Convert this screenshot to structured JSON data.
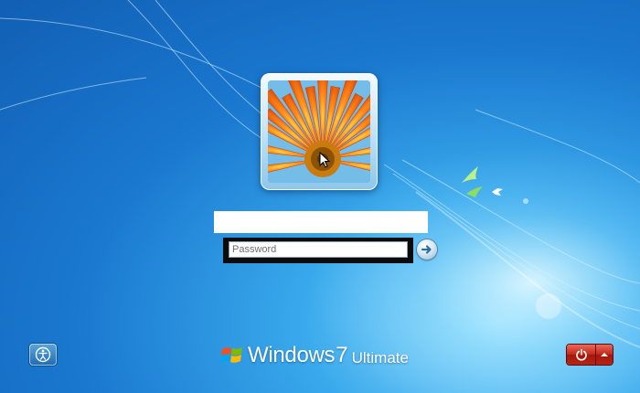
{
  "login": {
    "username": "",
    "password": {
      "value": "",
      "placeholder": "Password"
    }
  },
  "branding": {
    "name": "Windows",
    "version": "7",
    "edition": "Ultimate"
  },
  "icons": {
    "submit": "arrow-right-icon",
    "ease_of_access": "ease-of-access-icon",
    "power": "power-icon",
    "power_options": "chevron-up-icon"
  },
  "colors": {
    "background": "#1a78cf",
    "shutdown": "#c42a1b"
  }
}
